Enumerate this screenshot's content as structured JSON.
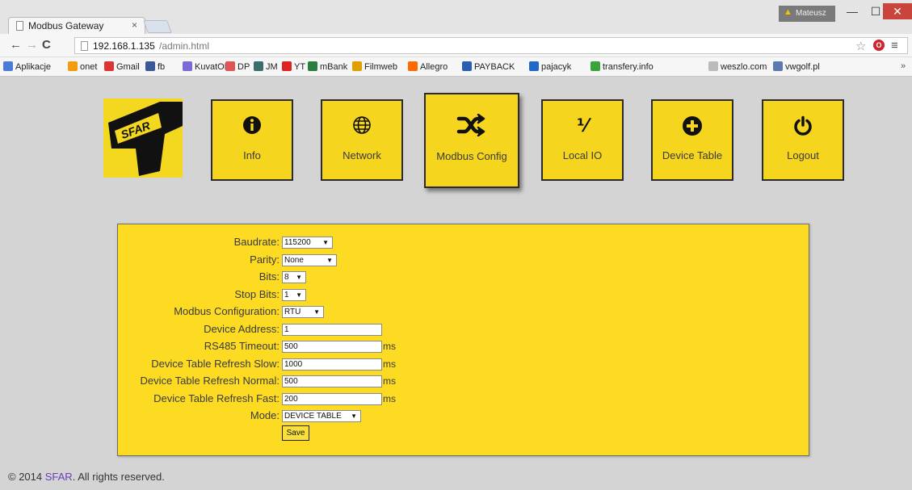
{
  "browser": {
    "tab_title": "Modbus Gateway",
    "tab_close": "×",
    "user_name": "Mateusz",
    "url_host": "192.168.1.135",
    "url_path": "/admin.html",
    "bookmarks": [
      {
        "label": "Aplikacje",
        "icon": "apps-grid-icon",
        "color": "#4a7bd6"
      },
      {
        "label": "onet",
        "icon": "onet-icon",
        "color": "#f39c12"
      },
      {
        "label": "Gmail",
        "icon": "gmail-icon",
        "color": "#d33"
      },
      {
        "label": "fb",
        "icon": "facebook-icon",
        "color": "#3b5998"
      },
      {
        "label": "KuvatON",
        "icon": "kuvaton-icon",
        "color": "#7a6ad6"
      },
      {
        "label": "DP",
        "icon": "dp-icon",
        "color": "#d55"
      },
      {
        "label": "JM",
        "icon": "jm-icon",
        "color": "#3a6e6e"
      },
      {
        "label": "YT",
        "icon": "youtube-icon",
        "color": "#d22"
      },
      {
        "label": "mBank",
        "icon": "mbank-icon",
        "color": "#2a7f3e"
      },
      {
        "label": "Filmweb",
        "icon": "filmweb-icon",
        "color": "#e0a000"
      },
      {
        "label": "Allegro",
        "icon": "allegro-icon",
        "color": "#ff6a00"
      },
      {
        "label": "PAYBACK",
        "icon": "payback-icon",
        "color": "#2a5fb0"
      },
      {
        "label": "pajacyk",
        "icon": "pajacyk-icon",
        "color": "#1f6ac9"
      },
      {
        "label": "transfery.info",
        "icon": "transfery-icon",
        "color": "#3aa33a"
      },
      {
        "label": "weszlo.com",
        "icon": "page-icon",
        "color": "#bbbbbb"
      },
      {
        "label": "vwgolf.pl",
        "icon": "vwgolf-icon",
        "color": "#5a7ab0"
      }
    ],
    "bookmarks_more": "»"
  },
  "nav": {
    "tiles": [
      {
        "label": "Info",
        "icon": "info-icon"
      },
      {
        "label": "Network",
        "icon": "globe-icon"
      },
      {
        "label": "Modbus Config",
        "icon": "shuffle-icon"
      },
      {
        "label": "Local IO",
        "icon": "percent-icon"
      },
      {
        "label": "Device Table",
        "icon": "plus-circle-icon"
      },
      {
        "label": "Logout",
        "icon": "power-icon"
      }
    ],
    "active": "Modbus Config"
  },
  "logo": {
    "text": "SFAR"
  },
  "form": {
    "fields": [
      {
        "label": "Baudrate:",
        "type": "select",
        "value": "115200"
      },
      {
        "label": "Parity:",
        "type": "select",
        "value": "None"
      },
      {
        "label": "Bits:",
        "type": "select",
        "value": "8"
      },
      {
        "label": "Stop Bits:",
        "type": "select",
        "value": "1"
      },
      {
        "label": "Modbus Configuration:",
        "type": "select",
        "value": "RTU"
      },
      {
        "label": "Device Address:",
        "type": "text",
        "value": "1"
      },
      {
        "label": "RS485 Timeout:",
        "type": "text",
        "value": "500",
        "unit": "ms"
      },
      {
        "label": "Device Table Refresh Slow:",
        "type": "text",
        "value": "1000",
        "unit": "ms"
      },
      {
        "label": "Device Table Refresh Normal:",
        "type": "text",
        "value": "500",
        "unit": "ms"
      },
      {
        "label": "Device Table Refresh Fast:",
        "type": "text",
        "value": "200",
        "unit": "ms"
      },
      {
        "label": "Mode:",
        "type": "select",
        "value": "DEVICE TABLE"
      }
    ],
    "save_label": "Save"
  },
  "footer": {
    "prefix": "© 2014 ",
    "brand": "SFAR",
    "suffix": ". All rights reserved."
  },
  "colors": {
    "tile_yellow": "#f5d51d",
    "panel_yellow": "#fcdb22",
    "page_bg": "#d4d4d4",
    "footer_link": "#6a3fb5"
  }
}
